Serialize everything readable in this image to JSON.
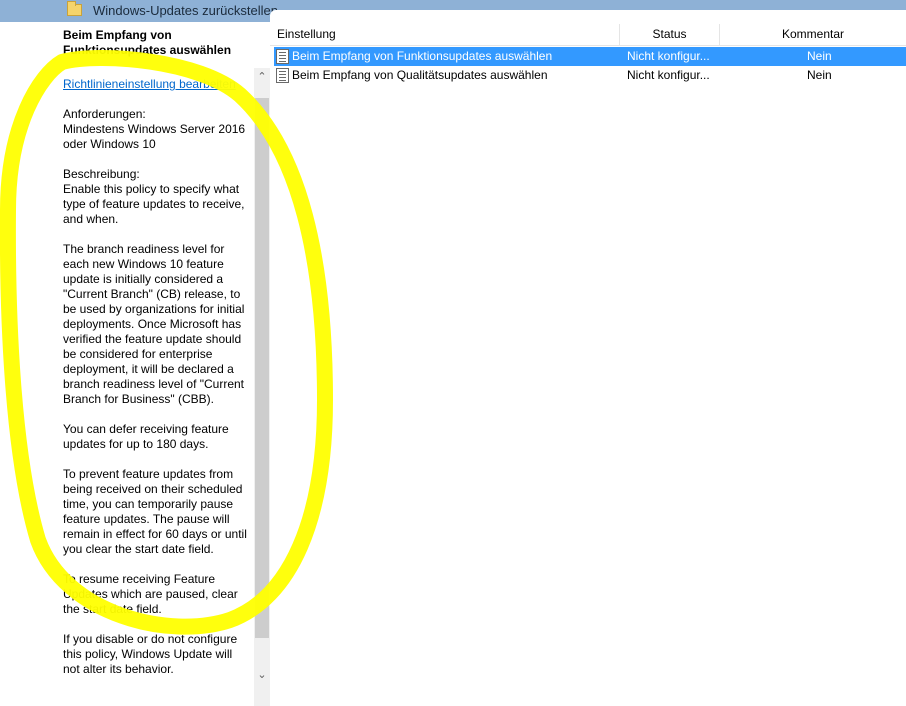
{
  "window": {
    "title": "Windows-Updates zurückstellen",
    "folder_icon": "folder-icon"
  },
  "left_pane": {
    "heading": "Beim Empfang von Funktionsupdates auswählen",
    "edit_link": "Richtlinieneinstellung bearbeiten",
    "requirements_label": "Anforderungen:",
    "requirements_text": "Mindestens Windows Server 2016 oder Windows 10",
    "description_label": "Beschreibung:",
    "description_paragraphs": [
      "Enable this policy to specify what type of feature updates to receive, and when.",
      "The branch readiness level for each new Windows 10 feature update is initially considered a \"Current Branch\" (CB) release, to be used by organizations for initial deployments. Once Microsoft has verified the feature update should be considered for enterprise deployment, it will be declared a branch readiness level of \"Current Branch for Business\" (CBB).",
      "You can defer receiving feature updates for up to 180 days.",
      "To prevent feature updates from being received on their scheduled time, you can temporarily pause feature updates. The pause will remain in effect for 60 days or until you clear the start date field.",
      "To resume receiving Feature Updates which are paused, clear the start date field.",
      "If you disable or do not configure this policy, Windows Update will not alter its behavior."
    ]
  },
  "scrollbar": {
    "up_icon": "chevron-up-icon",
    "down_icon": "chevron-down-icon"
  },
  "table": {
    "columns": {
      "setting": "Einstellung",
      "status": "Status",
      "comment": "Kommentar"
    },
    "rows": [
      {
        "name": "Beim Empfang von Funktionsupdates auswählen",
        "status": "Nicht konfigur...",
        "comment": "Nein",
        "selected": true,
        "icon": "policy-setting-icon"
      },
      {
        "name": "Beim Empfang von Qualitätsupdates auswählen",
        "status": "Nicht konfigur...",
        "comment": "Nein",
        "selected": false,
        "icon": "policy-setting-icon"
      }
    ]
  },
  "annotation": {
    "color": "#ffff00",
    "shape": "hand-drawn highlight loop around description"
  },
  "colors": {
    "selection": "#3399ff",
    "link": "#0066cc",
    "titlebar": "#8eb1d6"
  }
}
